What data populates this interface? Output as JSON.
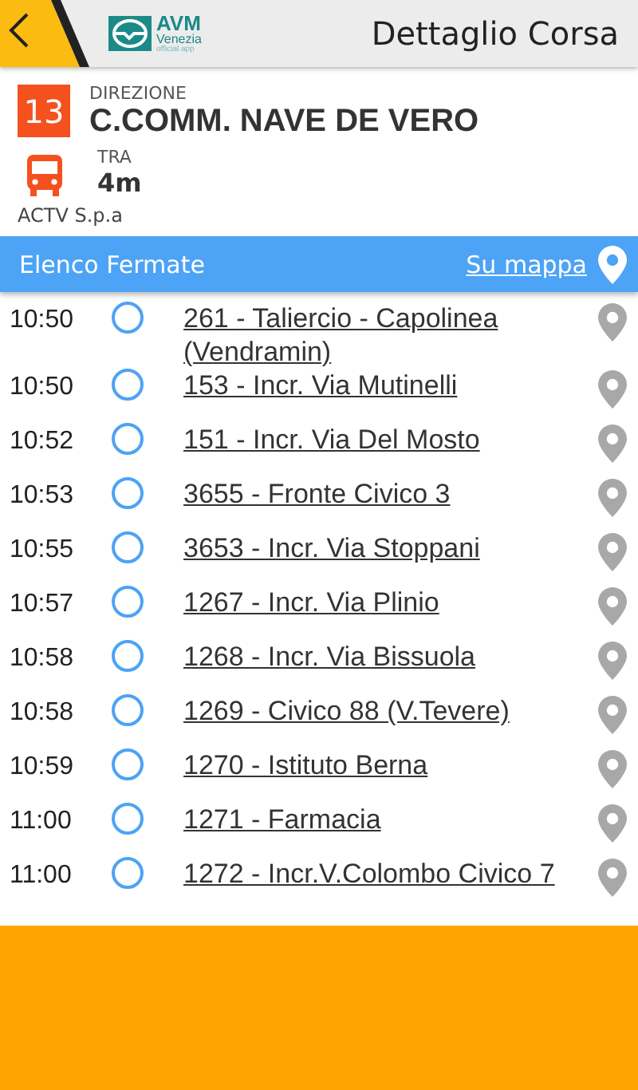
{
  "header": {
    "title": "Dettaglio Corsa",
    "logo": {
      "name": "AVM",
      "subtitle": "Venezia",
      "tagline": "official app"
    }
  },
  "trip": {
    "line": "13",
    "direction_label": "DIREZIONE",
    "direction": "C.COMM. NAVE DE VERO",
    "eta_label": "TRA",
    "eta": "4m",
    "operator": "ACTV S.p.a"
  },
  "stops_bar": {
    "title": "Elenco Fermate",
    "map_link": "Su mappa"
  },
  "stops": [
    {
      "time": "10:50",
      "name": "261 - Taliercio - Capolinea (Vendramin)"
    },
    {
      "time": "10:50",
      "name": "153 - Incr. Via Mutinelli"
    },
    {
      "time": "10:52",
      "name": "151 - Incr. Via Del Mosto"
    },
    {
      "time": "10:53",
      "name": "3655 - Fronte Civico 3"
    },
    {
      "time": "10:55",
      "name": "3653 - Incr. Via Stoppani"
    },
    {
      "time": "10:57",
      "name": "1267 - Incr. Via Plinio"
    },
    {
      "time": "10:58",
      "name": "1268 - Incr. Via Bissuola"
    },
    {
      "time": "10:58",
      "name": "1269 - Civico 88 (V.Tevere)"
    },
    {
      "time": "10:59",
      "name": "1270 - Istituto Berna"
    },
    {
      "time": "11:00",
      "name": "1271 - Farmacia"
    },
    {
      "time": "11:00",
      "name": "1272 - Incr.V.Colombo Civico 7"
    }
  ]
}
